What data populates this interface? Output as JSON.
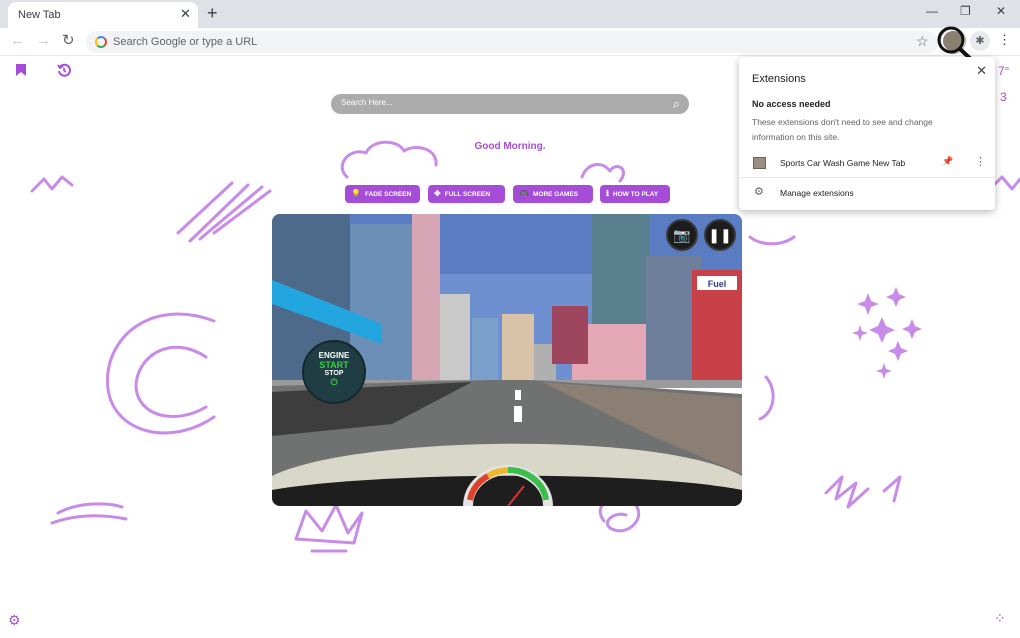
{
  "browser": {
    "tab_title": "New Tab",
    "tab_close": "✕",
    "new_tab": "+",
    "minimize": "—",
    "restore": "❐",
    "close": "✕",
    "back": "←",
    "forward": "→",
    "reload": "↻",
    "omnibox_placeholder": "Search Google or type a URL",
    "bookmark_star": "☆",
    "extensions_icon": "✱",
    "menu": "⋮"
  },
  "page": {
    "search_placeholder": "Search Here...",
    "search_icon": "⌕",
    "greeting": "Good Morning.",
    "buttons": [
      {
        "icon": "💡",
        "label": "FADE SCREEN"
      },
      {
        "icon": "✥",
        "label": "FULL SCREEN"
      },
      {
        "icon": "🎮",
        "label": "MORE GAMES"
      },
      {
        "icon": "ℹ",
        "label": "HOW TO PLAY"
      }
    ],
    "bookmark_icon": "bookmark-icon",
    "history_icon": "history-icon",
    "settings_icon": "⚙",
    "apps_icon": "⁘",
    "peek_temp": "7°",
    "peek_num": "3",
    "accent_color": "#a64dd8"
  },
  "game": {
    "engine_line1": "ENGINE",
    "engine_line2": "START",
    "engine_line3": "STOP",
    "power": "⏻",
    "camera": "📷",
    "pause": "❚❚",
    "billboard": "Fuel"
  },
  "extensions_popup": {
    "title": "Extensions",
    "close": "✕",
    "heading": "No access needed",
    "description": "These extensions don't need to see and change information on this site.",
    "extension_name": "Sports Car Wash Game New Tab",
    "pin": "📌",
    "more": "⋮",
    "manage_icon": "⚙",
    "manage_label": "Manage extensions"
  }
}
